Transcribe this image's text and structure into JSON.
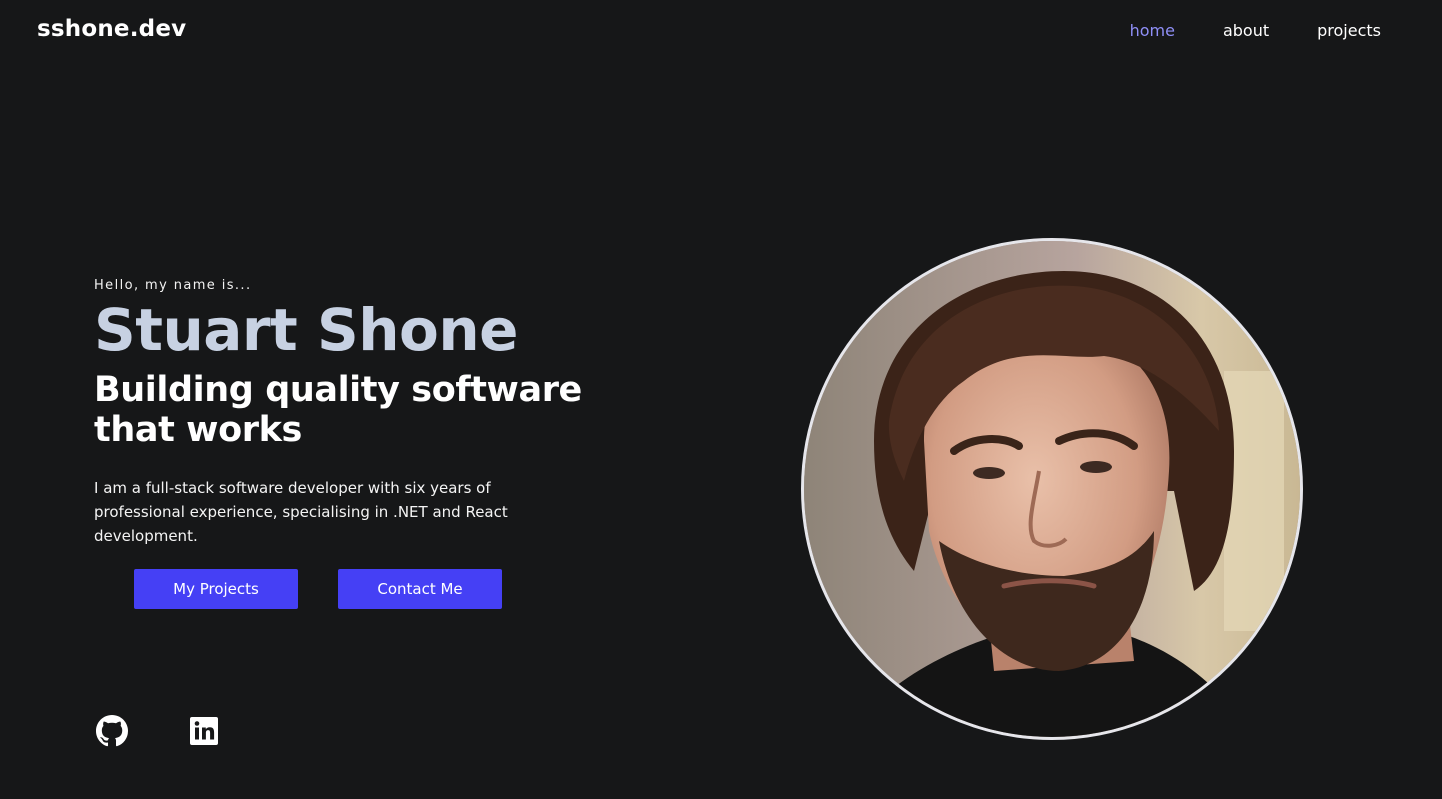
{
  "header": {
    "brand": "sshone.dev",
    "nav": [
      {
        "label": "home",
        "active": true
      },
      {
        "label": "about",
        "active": false
      },
      {
        "label": "projects",
        "active": false
      }
    ]
  },
  "hero": {
    "greeting": "Hello, my name is...",
    "name": "Stuart Shone",
    "tagline": "Building quality software that works",
    "intro": "I am a full-stack software developer with six years of professional experience, specialising in .NET and React development.",
    "buttons": {
      "projects": "My Projects",
      "contact": "Contact Me"
    }
  },
  "socials": [
    {
      "icon": "github-icon"
    },
    {
      "icon": "linkedin-icon"
    }
  ],
  "profile_photo": {
    "subject": "portrait"
  },
  "colors": {
    "background": "#161718",
    "accent": "#4540f5",
    "nav_active": "#8f8ff7",
    "name": "#c7d1e2"
  }
}
